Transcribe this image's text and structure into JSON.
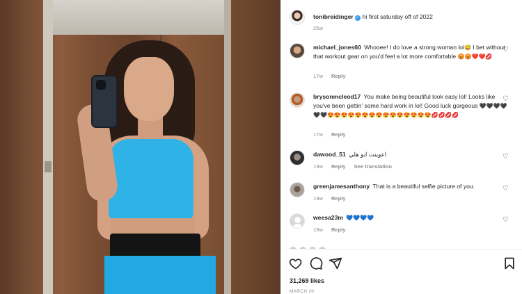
{
  "post": {
    "author": "tonibreidinger",
    "caption": "hi first saturday off of 2022",
    "age": "25w"
  },
  "comments": [
    {
      "user": "michael_jones60",
      "text": "Whooee! I do love a strong woman lol",
      "text2": " I bet without that workout gear on you'd feel a lot more comfortable ",
      "emojis": [
        "😅"
      ],
      "emojis2": [
        "😡",
        "😡",
        "❤️",
        "❤️",
        "💋"
      ],
      "age": "17w",
      "reply": "Reply"
    },
    {
      "user": "brysonmcleod17",
      "text": "You make being beautiful look easy lol! Looks like you've been gettin' some hard work in lol! Good luck gorgeous ",
      "emojis": [
        "🖤",
        "🖤",
        "🖤",
        "🖤",
        "🖤",
        "🖤",
        "😍",
        "😍",
        "😍",
        "😍",
        "😍",
        "😍",
        "😍",
        "😍",
        "😍",
        "😍",
        "😍",
        "😍",
        "😍",
        "😍",
        "😍",
        "💋",
        "💋",
        "💋",
        "💋"
      ],
      "age": "17w",
      "reply": "Reply"
    },
    {
      "user": "dawood_51",
      "text": "اعوينت ابو هلي",
      "age": "19w",
      "reply": "Reply",
      "translate": "See translation"
    },
    {
      "user": "greenjamesanthony",
      "text": "That is a beautiful selfie picture of you.",
      "age": "19w",
      "reply": "Reply"
    },
    {
      "user": "weesa23m",
      "emojis": [
        "💙",
        "💙",
        "💙",
        "💙"
      ],
      "age": "19w",
      "reply": "Reply"
    }
  ],
  "actions": {
    "icons": [
      "heart-icon",
      "comment-icon",
      "share-icon",
      "bookmark-icon"
    ],
    "likes": "31,269 likes",
    "date": "MARCH 20"
  },
  "colors": {
    "link_blue": "#3897f0",
    "meta_gray": "#8e8e8e",
    "text": "#262626",
    "top_blue": "#2fb2e6"
  }
}
